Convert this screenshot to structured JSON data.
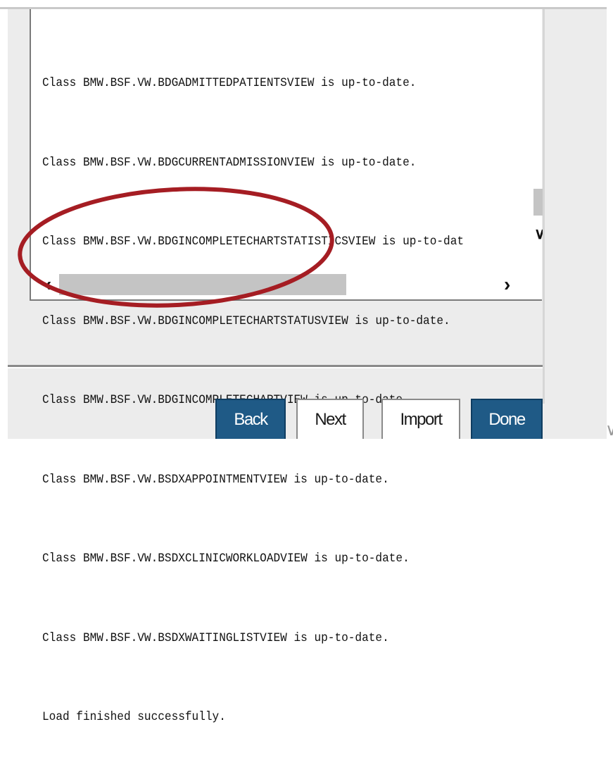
{
  "log": {
    "lines": [
      "Class BMW.BSF.VW.BDGADMITTEDPATIENTSVIEW is up-to-date.",
      "Class BMW.BSF.VW.BDGCURRENTADMISSIONVIEW is up-to-date.",
      "Class BMW.BSF.VW.BDGINCOMPLETECHARTSTATISTICSVIEW is up-to-dat",
      "Class BMW.BSF.VW.BDGINCOMPLETECHARTSTATUSVIEW is up-to-date.",
      "Class BMW.BSF.VW.BDGINCOMPLETECHARTVIEW is up-to-date.",
      "Class BMW.BSF.VW.BSDXAPPOINTMENTVIEW is up-to-date.",
      "Class BMW.BSF.VW.BSDXCLINICWORKLOADVIEW is up-to-date.",
      "Class BMW.BSF.VW.BSDXWAITINGLISTVIEW is up-to-date.",
      "Load finished successfully."
    ]
  },
  "scrollbar": {
    "down_glyph": "∨",
    "left_glyph": "‹",
    "right_glyph": "›"
  },
  "buttons": {
    "back": "Back",
    "next": "Next",
    "import": "Import",
    "done": "Done"
  },
  "edge_glyph": "∨",
  "colors": {
    "primary_button": "#1f5a86",
    "annotation_ellipse": "#a51d23",
    "panel_background": "#ececec"
  }
}
